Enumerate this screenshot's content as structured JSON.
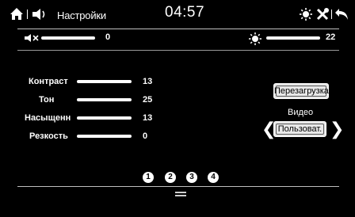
{
  "header": {
    "title": "Настройки",
    "time": "04:57"
  },
  "top_sliders": {
    "volume": {
      "value": "0",
      "level": 0.0
    },
    "brightness": {
      "value": "22",
      "level": 1.0
    }
  },
  "picture": {
    "items": [
      {
        "label": "Контраст",
        "value": "13"
      },
      {
        "label": "Тон",
        "value": "25"
      },
      {
        "label": "Насыщенн",
        "value": "13"
      },
      {
        "label": "Резкость",
        "value": "0"
      }
    ]
  },
  "actions": {
    "reboot_label": "Перезагрузка",
    "video_label": "Видео",
    "video_mode": "Пользоват."
  },
  "pager": {
    "pages": [
      "1",
      "2",
      "3",
      "4"
    ],
    "current": 1
  }
}
